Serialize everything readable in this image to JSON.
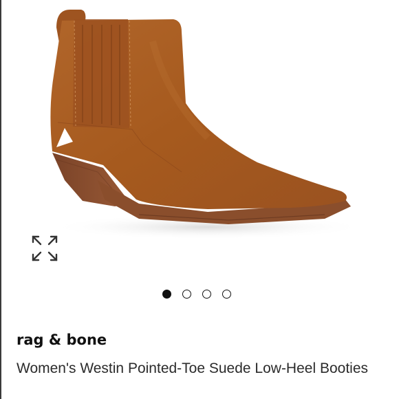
{
  "product": {
    "brand": "rag & bone",
    "title": "Women's Westin Pointed-Toe Suede Low-Heel Booties",
    "suede_color": "#A65A1E",
    "sole_color": "#8A4E2C"
  },
  "gallery": {
    "total_images": 4,
    "active_index": 0
  },
  "icons": {
    "expand": "expand-arrows-icon"
  }
}
